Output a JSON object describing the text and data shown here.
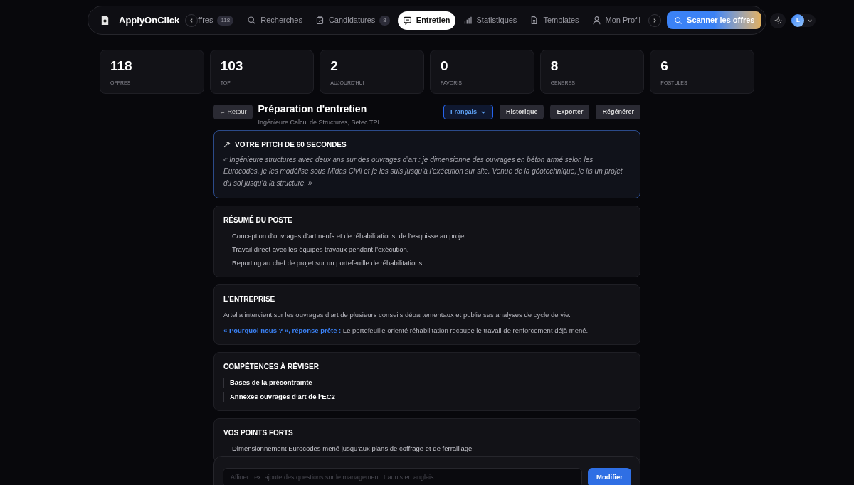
{
  "app": {
    "name": "ApplyOnClick"
  },
  "nav": {
    "tabs": [
      {
        "label": "ffres",
        "badge": "118",
        "selected": false
      },
      {
        "label": "Recherches",
        "selected": false
      },
      {
        "label": "Candidatures",
        "badge": "8",
        "selected": false
      },
      {
        "label": "Entretien",
        "selected": true
      },
      {
        "label": "Statistiques",
        "selected": false
      },
      {
        "label": "Templates",
        "selected": false
      },
      {
        "label": "Mon Profil",
        "selected": false
      }
    ],
    "scan_button": "Scanner les offres",
    "avatar": "L"
  },
  "stats": [
    {
      "value": "118",
      "label": "OFFRES"
    },
    {
      "value": "103",
      "label": "TOP"
    },
    {
      "value": "2",
      "label": "AUJOURD'HUI"
    },
    {
      "value": "0",
      "label": "FAVORIS"
    },
    {
      "value": "8",
      "label": "GENERES"
    },
    {
      "value": "6",
      "label": "POSTULES"
    }
  ],
  "header": {
    "back": "← Retour",
    "title": "Préparation d'entretien",
    "subtitle": "Ingénieure Calcul de Structures, Setec TPI",
    "language": "Français",
    "actions": [
      "Historique",
      "Exporter",
      "Régénérer"
    ]
  },
  "sections": [
    {
      "kind": "pitch",
      "title": "VOTRE PITCH DE 60 SECONDES",
      "text": "« Ingénieure structures avec deux ans sur des ouvrages d’art : je dimensionne des ouvrages en béton armé selon les Eurocodes, je les modélise sous Midas Civil et je les suis jusqu’à l’exécution sur site. Venue de la géotechnique, je lis un projet du sol jusqu’à la structure. »"
    },
    {
      "kind": "bullets",
      "title": "RÉSUMÉ DU POSTE",
      "items": [
        "Conception d’ouvrages d’art neufs et de réhabilitations, de l’esquisse au projet.",
        "Travail direct avec les équipes travaux pendant l’exécution.",
        "Reporting au chef de projet sur un portefeuille de réhabilitations."
      ]
    },
    {
      "kind": "paragraphs",
      "title": "L’ENTREPRISE",
      "items": [
        "Artelia intervient sur les ouvrages d’art de plusieurs conseils départementaux et publie ses analyses de cycle de vie.",
        "**« Pourquoi nous ? », réponse prête :** Le portefeuille orienté réhabilitation recoupe le travail de renforcement déjà mené."
      ]
    },
    {
      "kind": "skills",
      "title": "COMPÉTENCES À RÉVISER",
      "items": [
        "Bases de la précontrainte",
        "Annexes ouvrages d’art de l’EC2"
      ]
    },
    {
      "kind": "bullets",
      "title": "VOS POINTS FORTS",
      "items": [
        "Dimensionnement Eurocodes mené jusqu’aux plans de coffrage et de ferraillage."
      ]
    }
  ],
  "refine": {
    "placeholder": "Affiner : ex. ajoute des questions sur le management, traduis en anglais...",
    "button": "Modifier"
  }
}
